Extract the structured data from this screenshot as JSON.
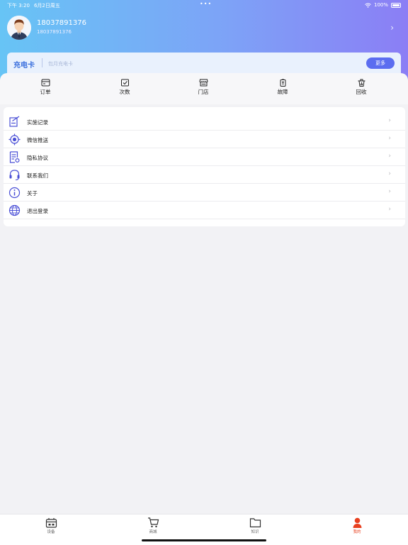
{
  "status_bar": {
    "time": "下午 3:20",
    "date": "6月2日周五",
    "dots": "•••",
    "battery": "100%"
  },
  "profile": {
    "name": "18037891376",
    "subtitle": "18037891376",
    "chevron": "›"
  },
  "card_banner": {
    "title": "充电卡",
    "subtitle": "包月充电卡",
    "more_label": "更多"
  },
  "quick_actions": [
    {
      "label": "订单",
      "icon": "order-icon"
    },
    {
      "label": "次数",
      "icon": "count-icon"
    },
    {
      "label": "门店",
      "icon": "store-icon"
    },
    {
      "label": "故障",
      "icon": "fault-icon"
    },
    {
      "label": "回收",
      "icon": "recycle-icon"
    }
  ],
  "menu": {
    "chevron": "›",
    "items": [
      {
        "label": "实施记录",
        "icon": "record-icon"
      },
      {
        "label": "微信推送",
        "icon": "push-icon"
      },
      {
        "label": "隐私协议",
        "icon": "privacy-icon"
      },
      {
        "label": "联系我们",
        "icon": "headset-icon"
      },
      {
        "label": "关于",
        "icon": "info-icon"
      },
      {
        "label": "退出登录",
        "icon": "globe-icon"
      }
    ]
  },
  "tabbar": {
    "tabs": [
      {
        "label": "设备",
        "icon": "device-icon",
        "active": false
      },
      {
        "label": "商城",
        "icon": "cart-icon",
        "active": false
      },
      {
        "label": "知识",
        "icon": "folder-icon",
        "active": false
      },
      {
        "label": "我的",
        "icon": "person-icon",
        "active": true
      }
    ]
  },
  "colors": {
    "accent": "#5b6df0",
    "active_tab": "#e8401f",
    "menu_icon": "#4a4fd6",
    "gradient_start": "#67c4f5",
    "gradient_end": "#8b7ef5"
  }
}
